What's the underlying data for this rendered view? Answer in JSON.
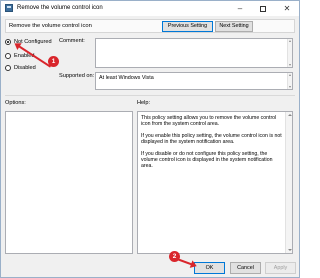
{
  "window": {
    "title": "Remove the volume control icon",
    "minimize_glyph": "–",
    "close_glyph": "✕"
  },
  "header": {
    "policy_name": "Remove the volume control icon",
    "previous_label": "Previous Setting",
    "next_label": "Next Setting"
  },
  "state": {
    "options": [
      {
        "label": "Not Configured",
        "selected": true
      },
      {
        "label": "Enabled",
        "selected": false
      },
      {
        "label": "Disabled",
        "selected": false
      }
    ]
  },
  "comment": {
    "label": "Comment:",
    "value": ""
  },
  "supported": {
    "label": "Supported on:",
    "value": "At least Windows Vista"
  },
  "options_panel": {
    "label": "Options:"
  },
  "help": {
    "label": "Help:",
    "paragraphs": [
      "This policy setting allows you to remove the volume control icon from the system control area.",
      "If you enable this policy setting, the volume control icon is not displayed in the system notification area.",
      "If you disable or do not configure this policy setting, the volume control icon is displayed in the system notification area."
    ]
  },
  "footer": {
    "ok_label": "OK",
    "cancel_label": "Cancel",
    "apply_label": "Apply"
  },
  "annotations": {
    "marker1": "1",
    "marker2": "2"
  },
  "colors": {
    "annotation": "#d9262c",
    "focus_border": "#0078d7"
  }
}
